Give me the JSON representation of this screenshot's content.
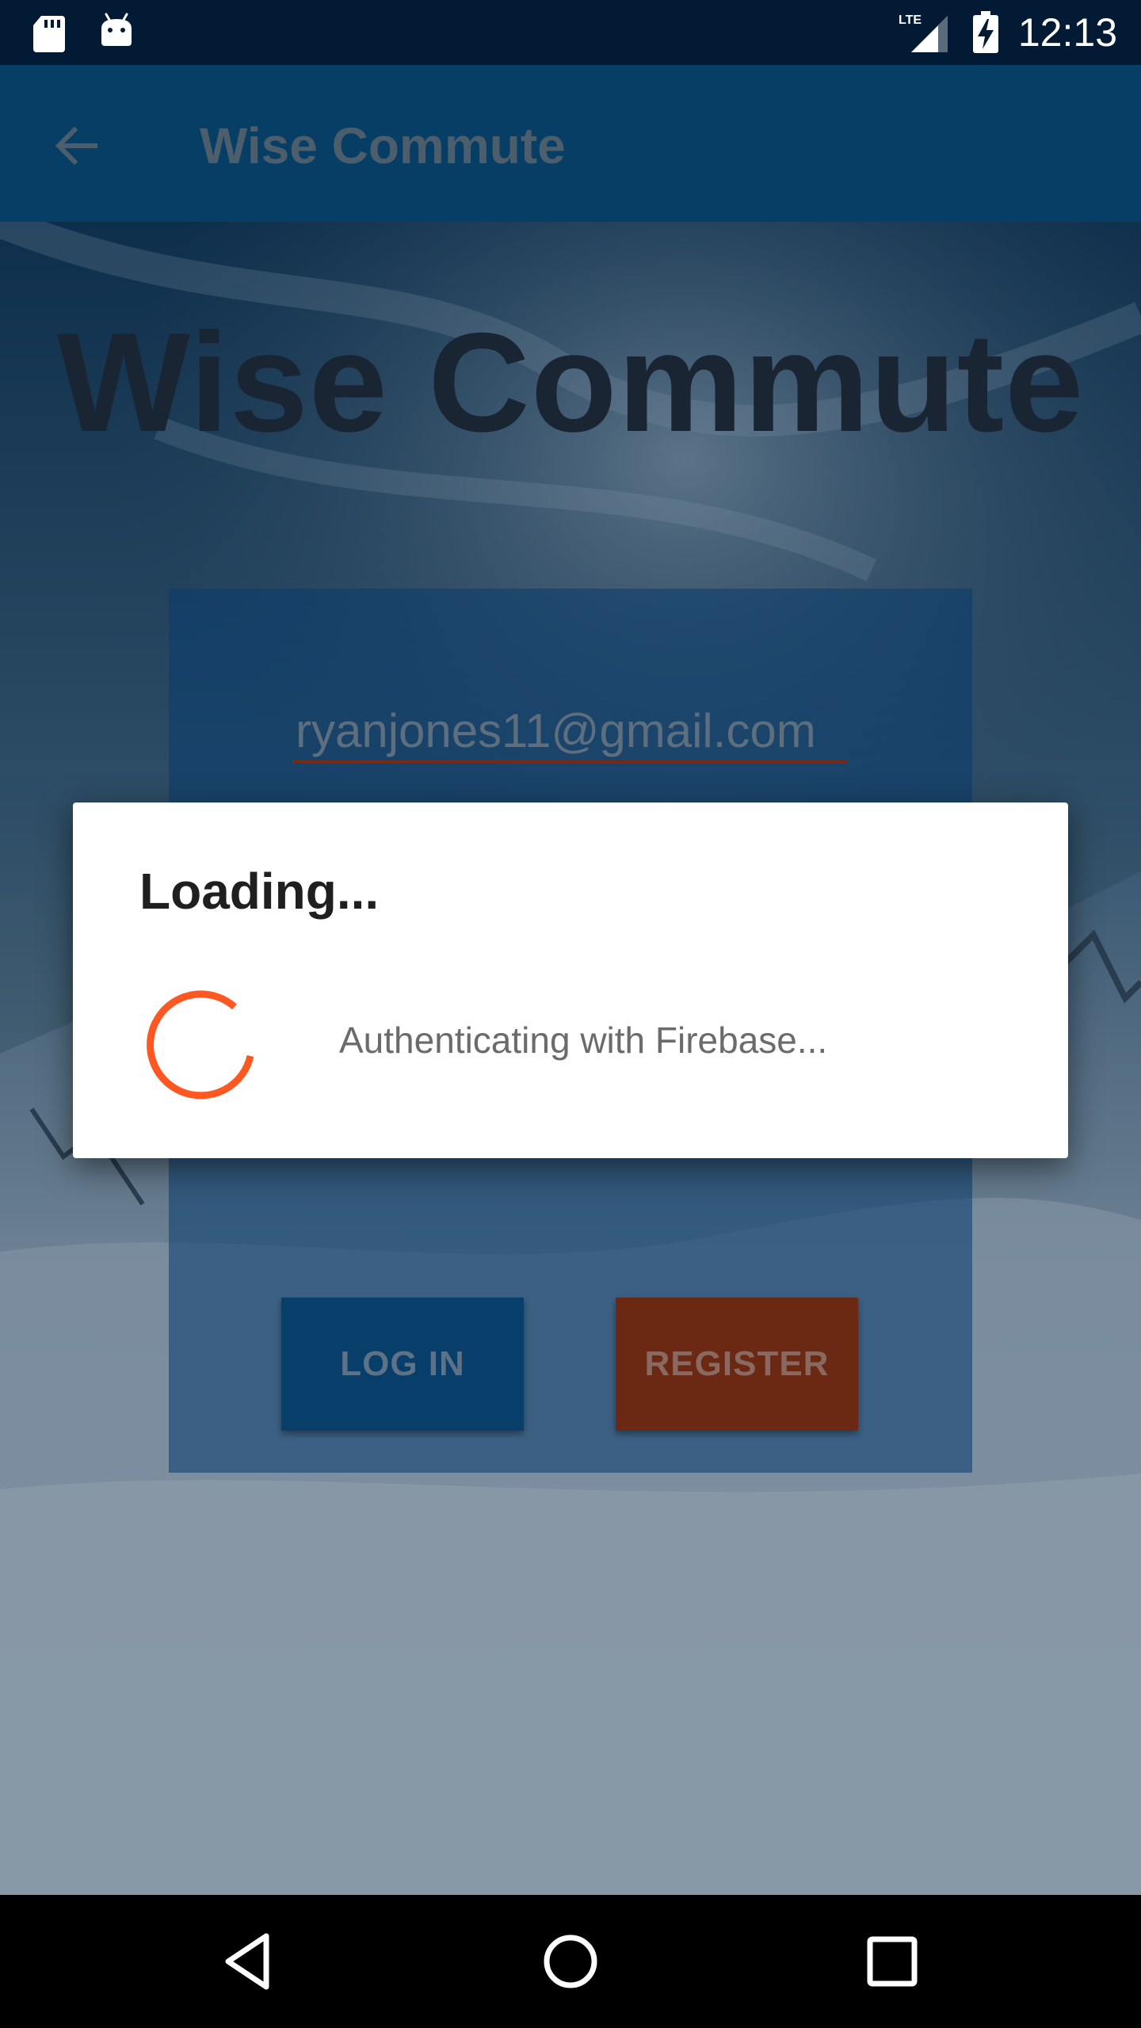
{
  "status_bar": {
    "time": "12:13",
    "network": "LTE",
    "icons": [
      "sd-card-icon",
      "android-icon",
      "lte-signal-icon",
      "battery-charging-icon"
    ]
  },
  "app_bar": {
    "title": "Wise Commute",
    "back_icon": "arrow-back-icon"
  },
  "hero": {
    "title": "Wise Commute"
  },
  "login_form": {
    "email_value": "ryanjones11@gmail.com",
    "login_label": "LOG IN",
    "register_label": "REGISTER"
  },
  "dialog": {
    "title": "Loading...",
    "message": "Authenticating with Firebase...",
    "spinner_color": "#ff5722"
  },
  "nav_bar": {
    "icons": [
      "nav-back-icon",
      "nav-home-icon",
      "nav-recents-icon"
    ]
  },
  "colors": {
    "status_bar": "#021a33",
    "app_bar": "#073e66",
    "login_button": "#073e6a",
    "register_button": "#6b2812",
    "accent": "#ff5722"
  }
}
